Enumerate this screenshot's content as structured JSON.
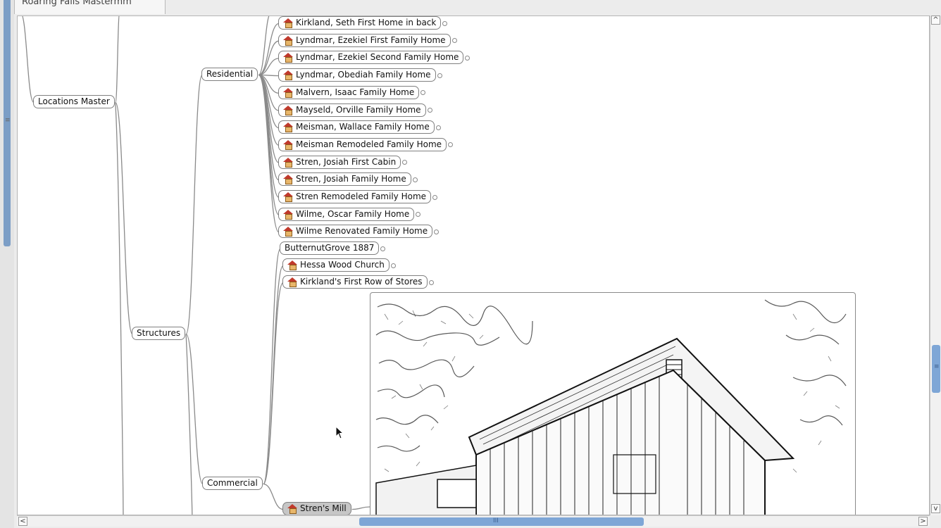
{
  "window": {
    "tab_title": "Roaring Falls Mastermm"
  },
  "mindmap": {
    "root_label": "Locations Master",
    "structures_label": "Structures",
    "residential_label": "Residential",
    "commercial_label": "Commercial",
    "residential_items": [
      "Kirkland, Seth First Home in back",
      "Lyndmar, Ezekiel First Family Home",
      "Lyndmar, Ezekiel Second Family Home",
      "Lyndmar, Obediah Family Home",
      "Malvern, Isaac Family Home",
      "Mayseld, Orville Family Home",
      "Meisman, Wallace Family Home",
      "Meisman Remodeled Family Home",
      "Stren, Josiah First Cabin",
      "Stren, Josiah Family Home",
      "Stren Remodeled Family Home",
      "Wilme, Oscar Family Home",
      "Wilme Renovated Family Home"
    ],
    "commercial_items": [
      "ButternutGrove 1887",
      "Hessa Wood Church",
      "Kirkland's First Row of Stores",
      "Stren's Mill"
    ],
    "image_node": "barn-photo-sketch"
  },
  "scrollbars": {
    "left_arrow": "<",
    "right_arrow": ">",
    "up_arrow": "^",
    "down_arrow": "v",
    "h_grip": "III",
    "v_grip": "≡"
  },
  "colors": {
    "scroll_thumb": "#7ea6d6",
    "edge": "#8a8a8a",
    "house_roof": "#c0392b"
  }
}
